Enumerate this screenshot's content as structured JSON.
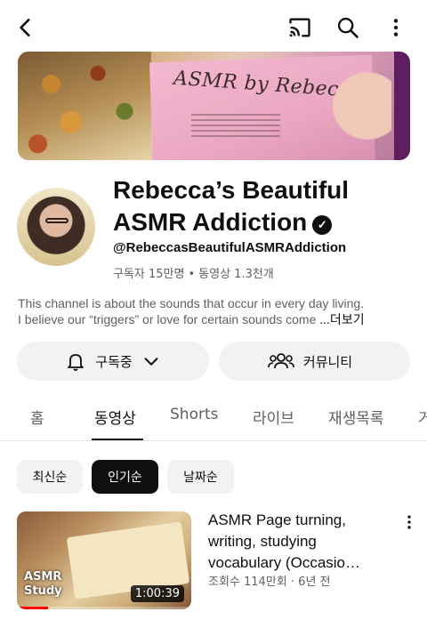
{
  "topbar": {
    "back_icon": "back-arrow-icon",
    "cast_icon": "cast-icon",
    "search_icon": "search-icon",
    "more_icon": "more-vert-icon"
  },
  "banner": {
    "text": "ASMR by Rebecca"
  },
  "channel": {
    "name": "Rebecca’s Beautiful ASMR Addiction",
    "verified_icon": "verified-check-icon",
    "handle": "@RebeccasBeautifulASMRAddiction",
    "subscribers": "구독자 15만명",
    "separator": "•",
    "videos": "동영상 1.3천개",
    "description_line1": "This channel is about the sounds that occur in every day living.",
    "description_line2": "I believe our “triggers” or love for certain sounds come",
    "more_label": "...더보기"
  },
  "actions": {
    "subscribe_label": "구독중",
    "bell_icon": "bell-icon",
    "chevron_icon": "chevron-down-icon",
    "community_label": "커뮤니티",
    "community_icon": "people-icon"
  },
  "tabs": {
    "home": "홈",
    "videos": "동영상",
    "shorts": "Shorts",
    "live": "라이브",
    "playlists": "재생목록",
    "overflow": "거"
  },
  "active_tab": "videos",
  "chips": {
    "latest": "최신순",
    "popular": "인기순",
    "oldest": "날짜순"
  },
  "active_chip": "popular",
  "video": {
    "title": "ASMR Page turning, writing, studying vocabulary  (Occasio…",
    "views": "조회수 114만회",
    "separator": "·",
    "age": "6년 전",
    "duration": "1:00:39",
    "thumb_text_line1": "ASMR",
    "thumb_text_line2": "Study",
    "watched_fraction": 0.18
  }
}
